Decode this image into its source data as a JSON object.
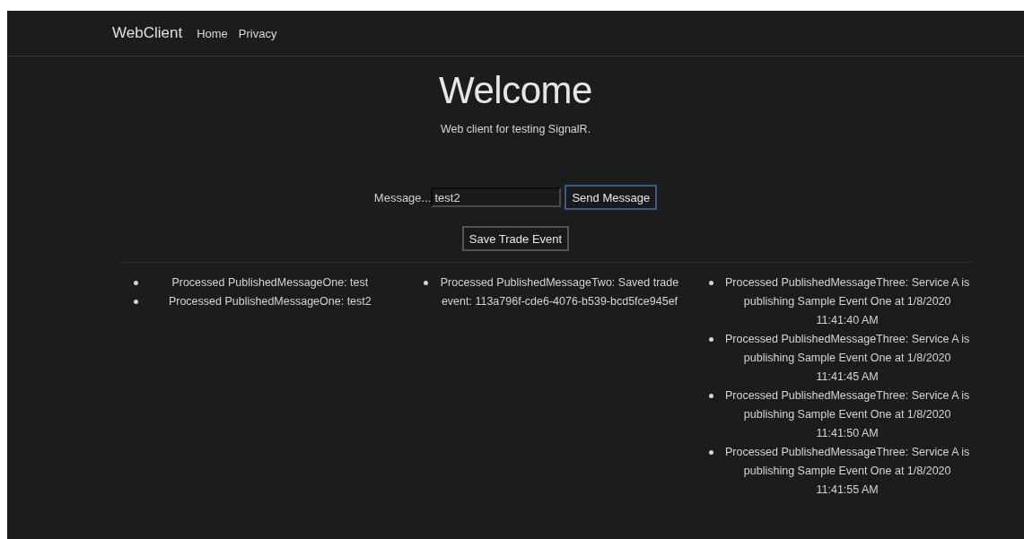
{
  "navbar": {
    "brand": "WebClient",
    "links": [
      "Home",
      "Privacy"
    ]
  },
  "hero": {
    "title": "Welcome",
    "subtitle": "Web client for testing SignalR."
  },
  "form": {
    "label": "Message...",
    "value": "test2",
    "send_button": "Send Message",
    "save_button": "Save Trade Event"
  },
  "lists": [
    {
      "items": [
        "Processed PublishedMessageOne: test",
        "Processed PublishedMessageOne: test2"
      ]
    },
    {
      "items": [
        "Processed PublishedMessageTwo: Saved trade event: 113a796f-cde6-4076-b539-bcd5fce945ef"
      ]
    },
    {
      "items": [
        "Processed PublishedMessageThree: Service A is publishing Sample Event One at 1/8/2020 11:41:40 AM",
        "Processed PublishedMessageThree: Service A is publishing Sample Event One at 1/8/2020 11:41:45 AM",
        "Processed PublishedMessageThree: Service A is publishing Sample Event One at 1/8/2020 11:41:50 AM",
        "Processed PublishedMessageThree: Service A is publishing Sample Event One at 1/8/2020 11:41:55 AM"
      ]
    }
  ]
}
